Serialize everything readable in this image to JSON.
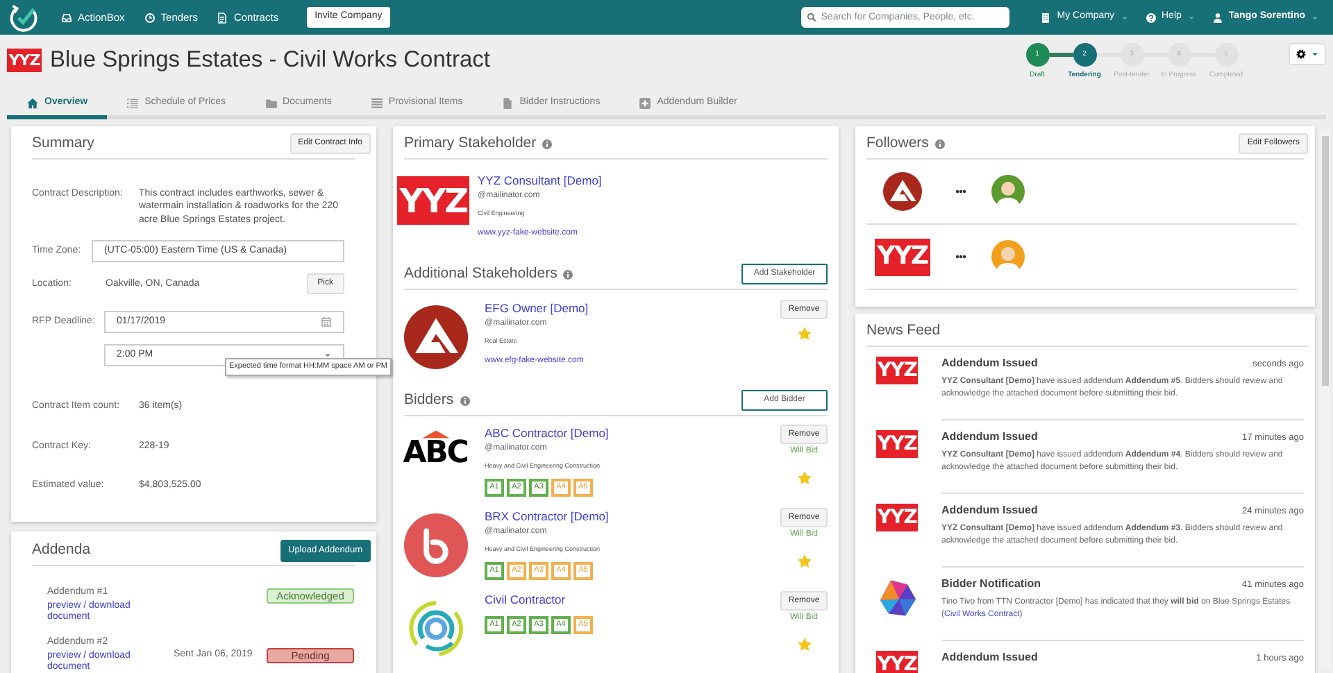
{
  "nav": {
    "items": [
      {
        "label": "ActionBox"
      },
      {
        "label": "Tenders"
      },
      {
        "label": "Contracts"
      }
    ],
    "invite": "Invite Company",
    "search": {
      "placeholder": "Search for Companies, People, etc."
    },
    "menus": [
      {
        "label": "My Company"
      },
      {
        "label": "Help"
      },
      {
        "label": "Tango Sorentino"
      }
    ]
  },
  "header": {
    "logo": "YYZ",
    "title": "Blue Springs Estates - Civil Works Contract",
    "steps": [
      {
        "number": "1",
        "label": "Draft",
        "completed": true,
        "selected": false
      },
      {
        "number": "2",
        "label": "Tendering",
        "completed": false,
        "selected": true
      },
      {
        "number": "3",
        "label": "Post-tender",
        "completed": false,
        "selected": false
      },
      {
        "number": "4",
        "label": "In Progress",
        "completed": false,
        "selected": false
      },
      {
        "number": "5",
        "label": "Completed",
        "completed": false,
        "selected": false
      }
    ]
  },
  "tabs": [
    {
      "label": "Overview",
      "selected": true
    },
    {
      "label": "Schedule of Prices",
      "selected": false
    },
    {
      "label": "Documents",
      "selected": false
    },
    {
      "label": "Provisional Items",
      "selected": false
    },
    {
      "label": "Bidder Instructions",
      "selected": false
    },
    {
      "label": "Addendum Builder",
      "selected": false
    }
  ],
  "summary": {
    "title": "Summary",
    "button": "Edit Contract Info",
    "fields": [
      {
        "kind": "text",
        "label": "Contract Description:",
        "value": "This contract includes earthworks, sewer & watermain installation & roadworks for the 220 acre Blue Springs Estates project."
      },
      {
        "kind": "input",
        "label": "Time Zone:",
        "value": "(UTC-05:00) Eastern Time (US & Canada)"
      },
      {
        "kind": "pick",
        "label": "Location:",
        "value": "Oakville, ON, Canada",
        "button": "Pick"
      },
      {
        "kind": "date",
        "label": "RFP Deadline:",
        "value": "01/17/2019"
      },
      {
        "kind": "select",
        "value": "2:00 PM",
        "tooltip": "Expected time format HH:MM space AM or PM"
      },
      {
        "kind": "text",
        "label": "Contract Item count:",
        "value": "36 item(s)"
      },
      {
        "kind": "text",
        "label": "Contract Key:",
        "value": "228-19"
      },
      {
        "kind": "text",
        "label": "Estimated value:",
        "value": "$4,803,525.00"
      }
    ]
  },
  "addenda": {
    "title": "Addenda",
    "button": "Upload Addendum",
    "items": [
      {
        "name": "Addendum #1",
        "link": "preview / download document",
        "status": "Acknowledged",
        "acknowledged": true
      },
      {
        "name": "Addendum #2",
        "link": "preview / download document",
        "sent": "Sent Jan 06, 2019",
        "status": "Pending",
        "acknowledged": false
      }
    ]
  },
  "primary_stakeholder": {
    "title": "Primary Stakeholder",
    "logo": {
      "kind": "wordmark",
      "text": "YYZ"
    },
    "name": "YYZ Consultant [Demo]",
    "email": "@mailinator.com",
    "industry": "Civil Engineering",
    "website": "www.yyz-fake-website.com"
  },
  "additional_stakeholders": {
    "title": "Additional Stakeholders",
    "button": "Add Stakeholder",
    "items": [
      {
        "logo": {
          "kind": "triangle"
        },
        "name": "EFG Owner [Demo]",
        "email": "@mailinator.com",
        "industry": "Real Estate",
        "website": "www.efg-fake-website.com",
        "remove": "Remove",
        "starred": true
      }
    ]
  },
  "bidders": {
    "title": "Bidders",
    "button": "Add Bidder",
    "items": [
      {
        "logo": {
          "kind": "roof",
          "text": "ABC"
        },
        "name": "ABC Contractor [Demo]",
        "email": "@mailinator.com",
        "industry": "Heavy and Civil Engineering Construction",
        "remove": "Remove",
        "status": "Will Bid",
        "starred": true,
        "addenda": [
          {
            "label": "A1",
            "acknowledged": true
          },
          {
            "label": "A2",
            "acknowledged": true
          },
          {
            "label": "A3",
            "acknowledged": true
          },
          {
            "label": "A4",
            "acknowledged": false
          },
          {
            "label": "A5",
            "acknowledged": false
          }
        ]
      },
      {
        "logo": {
          "kind": "bubble"
        },
        "name": "BRX Contractor [Demo]",
        "email": "@mailinator.com",
        "industry": "Heavy and Civil Engineering Construction",
        "remove": "Remove",
        "status": "Will Bid",
        "starred": true,
        "addenda": [
          {
            "label": "A1",
            "acknowledged": true
          },
          {
            "label": "A2",
            "acknowledged": false
          },
          {
            "label": "A3",
            "acknowledged": false
          },
          {
            "label": "A4",
            "acknowledged": false
          },
          {
            "label": "A5",
            "acknowledged": false
          }
        ]
      },
      {
        "logo": {
          "kind": "rings"
        },
        "name": "Civil Contractor",
        "remove": "Remove",
        "status": "Will Bid",
        "starred": true,
        "addenda": [
          {
            "label": "A1",
            "acknowledged": true
          },
          {
            "label": "A2",
            "acknowledged": true
          },
          {
            "label": "A3",
            "acknowledged": true
          },
          {
            "label": "A4",
            "acknowledged": true
          },
          {
            "label": "A5",
            "acknowledged": false
          }
        ]
      }
    ]
  },
  "followers": {
    "title": "Followers",
    "button": "Edit Followers",
    "rows": [
      {
        "company": {
          "kind": "triangle"
        },
        "color": "#5b9a2c"
      },
      {
        "company": {
          "kind": "wordmark",
          "text": "YYZ"
        },
        "color": "#f2a11f"
      }
    ]
  },
  "news_feed": {
    "title": "News Feed",
    "items": [
      {
        "logo": {
          "kind": "wordmark",
          "text": "YYZ"
        },
        "title": "Addendum Issued",
        "time": "seconds ago",
        "text": "**YYZ Consultant [Demo]** have issued addendum **Addendum #5**. Bidders should review and acknowledge the attached document before submitting their bid."
      },
      {
        "logo": {
          "kind": "wordmark",
          "text": "YYZ"
        },
        "title": "Addendum Issued",
        "time": "17 minutes ago",
        "text": "**YYZ Consultant [Demo]** have issued addendum **Addendum #4**. Bidders should review and acknowledge the attached document before submitting their bid."
      },
      {
        "logo": {
          "kind": "wordmark",
          "text": "YYZ"
        },
        "title": "Addendum Issued",
        "time": "24 minutes ago",
        "text": "**YYZ Consultant [Demo]** have issued addendum **Addendum #3**. Bidders should review and acknowledge the attached document before submitting their bid."
      },
      {
        "logo": {
          "kind": "gem"
        },
        "title": "Bidder Notification",
        "time": "41 minutes ago",
        "text": "Tino Tivo from TTN Contractor [Demo] has indicated that they **will bid** on Blue Springs Estates (",
        "link": "Civil Works Contract",
        "text_after": ")"
      },
      {
        "logo": {
          "kind": "wordmark",
          "text": "YYZ"
        },
        "title": "Addendum Issued",
        "time": "1 hours ago"
      }
    ]
  }
}
